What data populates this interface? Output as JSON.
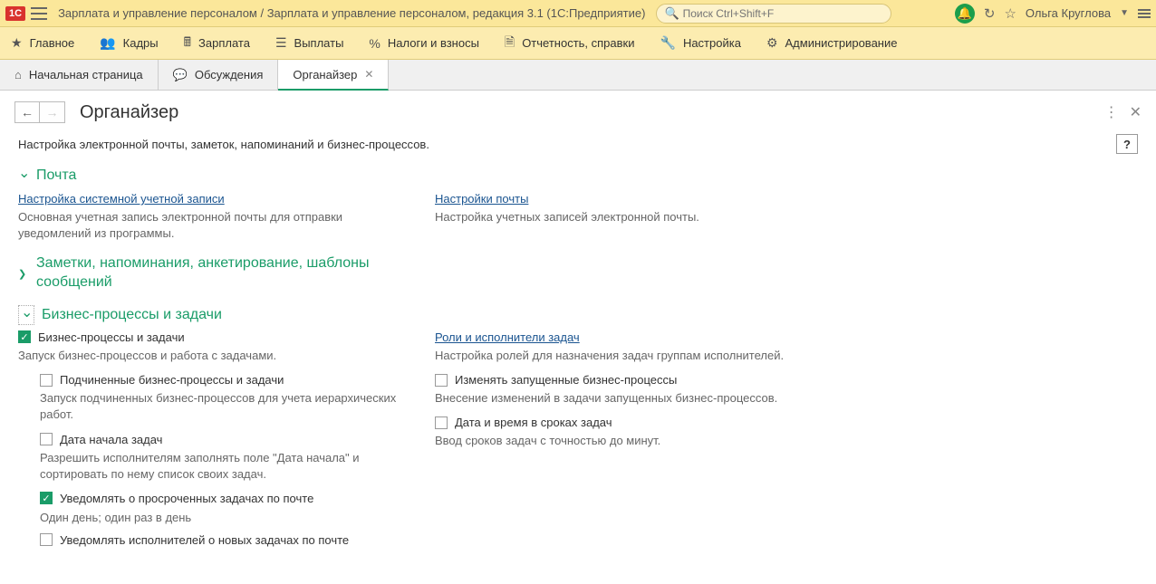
{
  "titlebar": {
    "title": "Зарплата и управление персоналом / Зарплата и управление персоналом, редакция 3.1  (1С:Предприятие)",
    "search_placeholder": "Поиск Ctrl+Shift+F",
    "username": "Ольга Круглова"
  },
  "nav": {
    "main": "Главное",
    "staff": "Кадры",
    "salary": "Зарплата",
    "payments": "Выплаты",
    "taxes": "Налоги и взносы",
    "reports": "Отчетность, справки",
    "setup": "Настройка",
    "admin": "Администрирование"
  },
  "tabs": {
    "start": "Начальная страница",
    "discuss": "Обсуждения",
    "organizer": "Органайзер"
  },
  "page": {
    "title": "Органайзер",
    "subtitle": "Настройка электронной почты, заметок, напоминаний и бизнес-процессов.",
    "help": "?"
  },
  "mail": {
    "header": "Почта",
    "link1": "Настройка системной учетной записи",
    "desc1": "Основная учетная запись электронной почты для отправки уведомлений из программы.",
    "link2": "Настройки почты",
    "desc2": "Настройка учетных записей электронной почты."
  },
  "notes": {
    "header": "Заметки, напоминания, анкетирование, шаблоны сообщений"
  },
  "bp": {
    "header": "Бизнес-процессы и задачи",
    "cb_main": "Бизнес-процессы и задачи",
    "main_desc": "Запуск бизнес-процессов и работа с задачами.",
    "link_roles": "Роли и исполнители задач",
    "roles_desc": "Настройка ролей для назначения задач группам исполнителей.",
    "cb_sub": "Подчиненные бизнес-процессы и задачи",
    "sub_desc": "Запуск подчиненных бизнес-процессов для учета иерархических работ.",
    "cb_change": "Изменять запущенные бизнес-процессы",
    "change_desc": "Внесение изменений в задачи запущенных бизнес-процессов.",
    "cb_startdate": "Дата начала задач",
    "startdate_desc": "Разрешить исполнителям заполнять поле \"Дата начала\" и сортировать по нему список своих задач.",
    "cb_datetime": "Дата и время в сроках задач",
    "datetime_desc": "Ввод сроков задач с точностью до минут.",
    "cb_notify_overdue": "Уведомлять о просроченных задачах по почте",
    "freq": "Один день; один раз в день",
    "cb_notify_new": "Уведомлять исполнителей о новых задачах по почте"
  }
}
